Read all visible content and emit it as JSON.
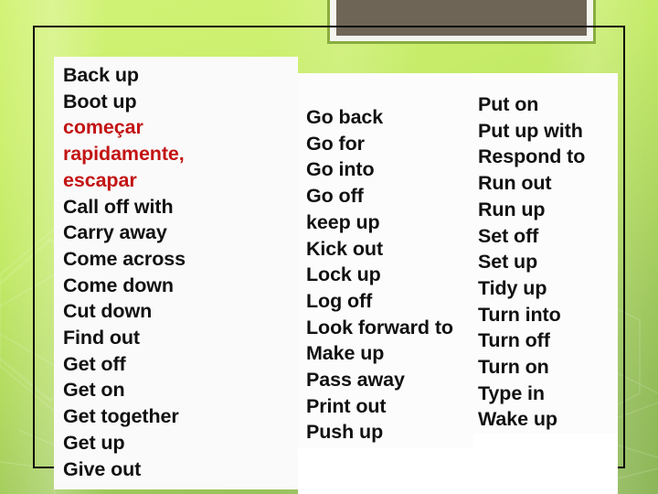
{
  "slide": {
    "title_block": {
      "name": "header-decoration-block",
      "fill_color": "#6e6556",
      "border_color": "#8aad3f",
      "text": ""
    },
    "background": {
      "top_color": "#d2f377",
      "bottom_color": "#8cb657"
    },
    "accent_red": "#c31414",
    "text_color": "#111111"
  },
  "columns": {
    "left": {
      "name": "phrasal-verbs-column-one",
      "items": [
        {
          "text": "Back up",
          "highlight": false
        },
        {
          "text": "Boot up",
          "highlight": false
        },
        {
          "text": "começar",
          "highlight": true
        },
        {
          "text": "rapidamente,",
          "highlight": true
        },
        {
          "text": "escapar",
          "highlight": true
        },
        {
          "text": "Call off with",
          "highlight": false
        },
        {
          "text": "Carry away",
          "highlight": false
        },
        {
          "text": "Come across",
          "highlight": false
        },
        {
          "text": "Come down",
          "highlight": false
        },
        {
          "text": "Cut down",
          "highlight": false
        },
        {
          "text": "Find out",
          "highlight": false
        },
        {
          "text": "Get off",
          "highlight": false
        },
        {
          "text": "Get on",
          "highlight": false
        },
        {
          "text": "Get together",
          "highlight": false
        },
        {
          "text": "Get up",
          "highlight": false
        },
        {
          "text": "Give out",
          "highlight": false
        }
      ]
    },
    "middle": {
      "name": "phrasal-verbs-column-two",
      "items": [
        {
          "text": "Go back",
          "highlight": false
        },
        {
          "text": "Go for",
          "highlight": false
        },
        {
          "text": "Go into",
          "highlight": false
        },
        {
          "text": "Go off",
          "highlight": false
        },
        {
          "text": "keep up",
          "highlight": false
        },
        {
          "text": "Kick out",
          "highlight": false
        },
        {
          "text": "Lock up",
          "highlight": false
        },
        {
          "text": "Log off",
          "highlight": false
        },
        {
          "text": "Look forward to",
          "highlight": false
        },
        {
          "text": "Make up",
          "highlight": false
        },
        {
          "text": "Pass away",
          "highlight": false
        },
        {
          "text": "Print out",
          "highlight": false
        },
        {
          "text": "Push up",
          "highlight": false
        }
      ]
    },
    "right": {
      "name": "phrasal-verbs-column-three",
      "items": [
        {
          "text": "Put on",
          "highlight": false
        },
        {
          "text": "Put up with",
          "highlight": false
        },
        {
          "text": "Respond to",
          "highlight": false
        },
        {
          "text": "Run out",
          "highlight": false
        },
        {
          "text": "Run up",
          "highlight": false
        },
        {
          "text": "Set off",
          "highlight": false
        },
        {
          "text": "Set up",
          "highlight": false
        },
        {
          "text": "Tidy up",
          "highlight": false
        },
        {
          "text": "Turn into",
          "highlight": false
        },
        {
          "text": "Turn off",
          "highlight": false
        },
        {
          "text": "Turn on",
          "highlight": false
        },
        {
          "text": "Type in",
          "highlight": false
        },
        {
          "text": "Wake up",
          "highlight": false
        }
      ]
    }
  }
}
